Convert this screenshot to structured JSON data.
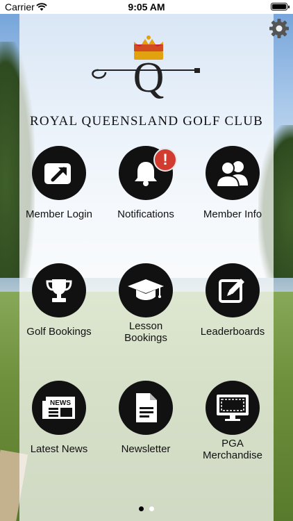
{
  "status_bar": {
    "carrier": "Carrier",
    "time": "9:05 AM"
  },
  "club": {
    "name": "ROYAL QUEENSLAND GOLF CLUB",
    "logo_letter": "Q"
  },
  "tiles": [
    {
      "label": "Member Login",
      "icon": "login-arrow-icon"
    },
    {
      "label": "Notifications",
      "icon": "bell-icon",
      "badge": "!"
    },
    {
      "label": "Member Info",
      "icon": "members-icon"
    },
    {
      "label": "Golf Bookings",
      "icon": "trophy-icon"
    },
    {
      "label_lines": [
        "Lesson",
        "Bookings"
      ],
      "icon": "graduation-cap-icon"
    },
    {
      "label": "Leaderboards",
      "icon": "edit-pencil-icon"
    },
    {
      "label": "Latest News",
      "icon": "newspaper-icon",
      "news_text": "NEWS"
    },
    {
      "label": "Newsletter",
      "icon": "document-icon"
    },
    {
      "label_lines": [
        "PGA",
        "Merchandise"
      ],
      "icon": "monitor-icon"
    }
  ],
  "pagination": {
    "pages": 2,
    "current": 1
  },
  "colors": {
    "icon_bg": "#111111",
    "badge": "#d23b2f",
    "panel": "rgba(255,255,255,0.72)",
    "crown": "#e2a20f"
  }
}
